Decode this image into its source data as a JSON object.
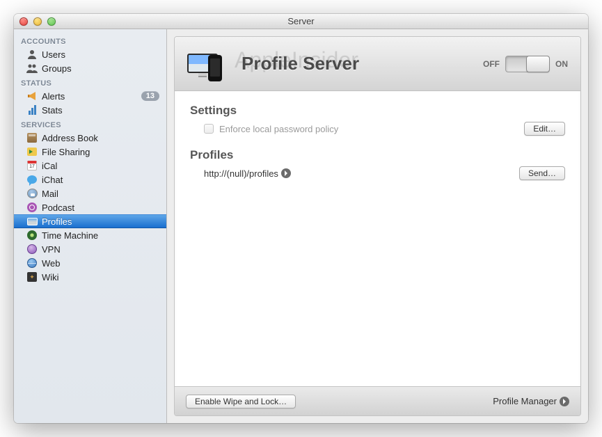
{
  "window": {
    "title": "Server"
  },
  "watermark": "AppleInsider",
  "sidebar": {
    "sections": [
      {
        "header": "ACCOUNTS",
        "items": [
          {
            "label": "Users",
            "icon": "person-icon"
          },
          {
            "label": "Groups",
            "icon": "group-icon"
          }
        ]
      },
      {
        "header": "STATUS",
        "items": [
          {
            "label": "Alerts",
            "icon": "megaphone-icon",
            "badge": "13"
          },
          {
            "label": "Stats",
            "icon": "bars-icon"
          }
        ]
      },
      {
        "header": "SERVICES",
        "items": [
          {
            "label": "Address Book",
            "icon": "book-icon"
          },
          {
            "label": "File Sharing",
            "icon": "folder-share-icon"
          },
          {
            "label": "iCal",
            "icon": "calendar-icon",
            "icon_text": "17"
          },
          {
            "label": "iChat",
            "icon": "chat-icon"
          },
          {
            "label": "Mail",
            "icon": "stamp-icon"
          },
          {
            "label": "Podcast",
            "icon": "podcast-icon"
          },
          {
            "label": "Profiles",
            "icon": "profiles-icon",
            "selected": true
          },
          {
            "label": "Time Machine",
            "icon": "timemachine-icon"
          },
          {
            "label": "VPN",
            "icon": "vpn-icon"
          },
          {
            "label": "Web",
            "icon": "globe-icon"
          },
          {
            "label": "Wiki",
            "icon": "wiki-icon"
          }
        ]
      }
    ]
  },
  "header": {
    "title": "Profile Server",
    "toggle": {
      "off_label": "OFF",
      "on_label": "ON",
      "state": "on"
    }
  },
  "settings": {
    "title": "Settings",
    "enforce_label": "Enforce local password policy",
    "enforce_checked": false,
    "edit_button": "Edit…"
  },
  "profiles": {
    "title": "Profiles",
    "url": "http://(null)/profiles",
    "send_button": "Send…"
  },
  "footer": {
    "wipe_button": "Enable Wipe and Lock…",
    "manager_link": "Profile Manager"
  }
}
